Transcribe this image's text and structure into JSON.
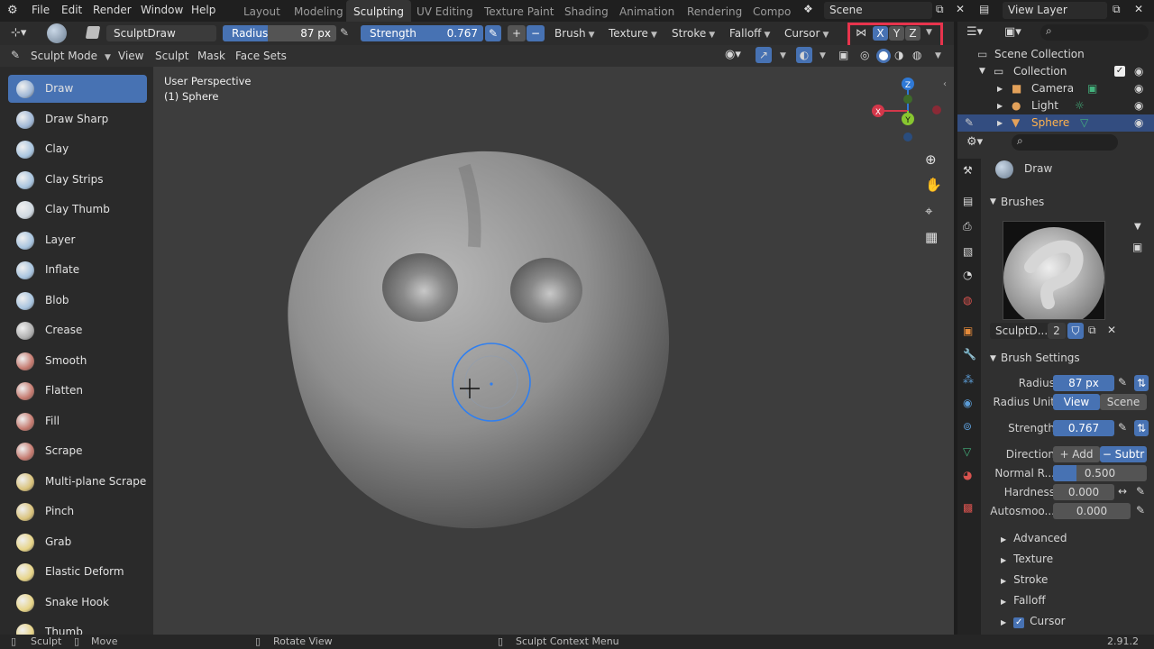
{
  "menubar": {
    "items": [
      "File",
      "Edit",
      "Render",
      "Window",
      "Help"
    ],
    "workspaces": [
      "Layout",
      "Modeling",
      "Sculpting",
      "UV Editing",
      "Texture Paint",
      "Shading",
      "Animation",
      "Rendering",
      "Compo"
    ],
    "active_workspace": "Sculpting",
    "scene": "Scene",
    "view_layer": "View Layer"
  },
  "toolsettings": {
    "brush_name": "SculptDraw",
    "radius_label": "Radius",
    "radius_value": "87 px",
    "strength_label": "Strength",
    "strength_value": "0.767",
    "plus": "+",
    "minus": "−",
    "dropdowns": [
      "Brush",
      "Texture",
      "Stroke",
      "Falloff",
      "Cursor"
    ],
    "symmetry": [
      "X",
      "Y",
      "Z"
    ]
  },
  "moderow": {
    "mode": "Sculpt Mode",
    "menus": [
      "View",
      "Sculpt",
      "Mask",
      "Face Sets"
    ]
  },
  "toolbar": {
    "tools": [
      {
        "label": "Draw",
        "active": true
      },
      {
        "label": "Draw Sharp"
      },
      {
        "label": "Clay"
      },
      {
        "label": "Clay Strips"
      },
      {
        "label": "Clay Thumb"
      },
      {
        "label": "Layer"
      },
      {
        "label": "Inflate"
      },
      {
        "label": "Blob"
      },
      {
        "label": "Crease"
      },
      {
        "label": "Smooth"
      },
      {
        "label": "Flatten"
      },
      {
        "label": "Fill"
      },
      {
        "label": "Scrape"
      },
      {
        "label": "Multi-plane Scrape"
      },
      {
        "label": "Pinch"
      },
      {
        "label": "Grab"
      },
      {
        "label": "Elastic Deform"
      },
      {
        "label": "Snake Hook"
      },
      {
        "label": "Thumb"
      }
    ]
  },
  "viewport": {
    "perspective": "User Perspective",
    "object": "(1) Sphere",
    "gizmo": {
      "x": "X",
      "y": "Y",
      "z": "Z"
    }
  },
  "outliner": {
    "scene_collection": "Scene Collection",
    "collection": "Collection",
    "items": [
      "Camera",
      "Light",
      "Sphere"
    ]
  },
  "properties": {
    "active_tool": "Draw",
    "brushes_header": "Brushes",
    "brush_slot": "SculptD...",
    "brush_users": "2",
    "brush_settings_header": "Brush Settings",
    "radius_label": "Radius",
    "radius_value": "87 px",
    "radius_unit_label": "Radius Unit",
    "radius_unit_view": "View",
    "radius_unit_scene": "Scene",
    "strength_label": "Strength",
    "strength_value": "0.767",
    "direction_label": "Direction",
    "direction_add": "+ Add",
    "direction_sub": "− Subtr",
    "normal_label": "Normal R...",
    "normal_value": "0.500",
    "normal_fraction": 0.5,
    "hardness_label": "Hardness",
    "hardness_value": "0.000",
    "autosmooth_label": "Autosmoo...",
    "autosmooth_value": "0.000",
    "subpanels": [
      "Advanced",
      "Texture",
      "Stroke",
      "Falloff",
      "Cursor"
    ]
  },
  "statusbar": {
    "items": [
      "Sculpt",
      "Move",
      "Rotate View",
      "Sculpt Context Menu"
    ],
    "version": "2.91.2"
  },
  "colors": {
    "accent": "#4772b3",
    "highlight_box": "#e8344d",
    "axis_x": "#d4374a",
    "axis_y": "#88c630",
    "axis_z": "#2f79d6"
  }
}
